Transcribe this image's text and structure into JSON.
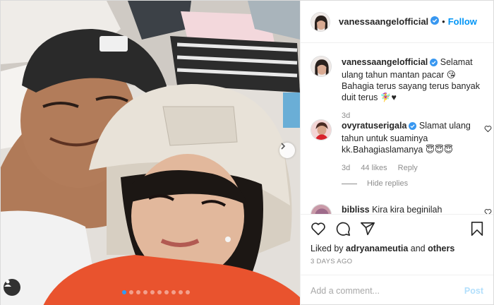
{
  "post": {
    "author": "vanessaangelofficial",
    "follow_label": "Follow",
    "separator": "•"
  },
  "photo": {
    "dot_count": 10,
    "active_dot": 0
  },
  "comments": [
    {
      "user": "vanessaangelofficial",
      "verified": true,
      "text": "Selamat ulang tahun mantan pacar 😘 Bahagia terus sayang terus banyak duit terus 🧚‍♀️♥",
      "time": "3d"
    },
    {
      "user": "ovyratuserigala",
      "verified": true,
      "text": "Slamat ulang tahun untuk suaminya kk.Bahagiaslamanya 😇😇😇",
      "time": "3d",
      "likes": "44 likes",
      "reply_label": "Reply"
    },
    {
      "user": "bibliss",
      "text": "Kira kira beginilah"
    }
  ],
  "hide_replies_label": "Hide replies",
  "likes": {
    "prefix": "Liked by",
    "user": "adryanameutia",
    "and": "and",
    "others": "others"
  },
  "date": "3 DAYS AGO",
  "add_comment": {
    "placeholder": "Add a comment...",
    "post_label": "Post"
  },
  "colors": {
    "accent": "#0095f6",
    "verified": "#3897f0",
    "active_dot": "#2f9cf6"
  },
  "icons": [
    "heart-icon",
    "comment-icon",
    "share-icon",
    "save-icon",
    "verified-icon",
    "user-tag-icon",
    "chevron-right-icon"
  ]
}
